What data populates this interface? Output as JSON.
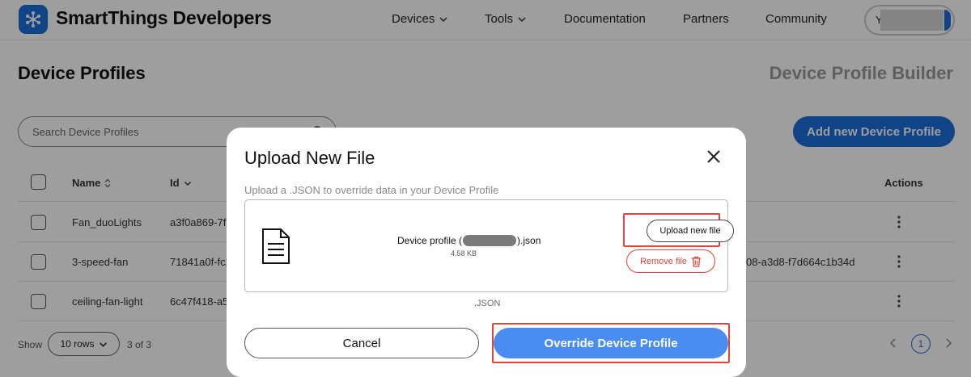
{
  "header": {
    "brand": "SmartThings Developers",
    "nav": {
      "devices": "Devices",
      "tools": "Tools",
      "documentation": "Documentation",
      "partners": "Partners",
      "community": "Community"
    },
    "user_initial": "Y"
  },
  "page": {
    "title": "Device Profiles",
    "builder_link": "Device Profile Builder",
    "search_placeholder": "Search Device Profiles",
    "add_button": "Add new Device Profile"
  },
  "table": {
    "columns": {
      "name": "Name",
      "id": "Id",
      "actions": "Actions"
    },
    "rows": [
      {
        "name": "Fan_duoLights",
        "id_visible": "a3f0a869-7f",
        "id_tail": ""
      },
      {
        "name": "3-speed-fan",
        "id_visible": "71841a0f-fc2",
        "id_tail": "08-a3d8-f7d664c1b34d"
      },
      {
        "name": "ceiling-fan-light",
        "id_visible": "6c47f418-a5",
        "id_tail": ""
      }
    ]
  },
  "footer": {
    "show_label": "Show",
    "rows_value": "10 rows",
    "count": "3 of 3",
    "current_page": "1"
  },
  "modal": {
    "title": "Upload New File",
    "subtitle": "Upload a .JSON to override data in your Device Profile",
    "file_name_prefix": "Device profile (",
    "file_name_suffix": ").json",
    "file_size": "4.58 KB",
    "upload_button": "Upload new file",
    "remove_button": "Remove file",
    "hint": ".JSON",
    "cancel_button": "Cancel",
    "override_button": "Override Device Profile"
  },
  "colors": {
    "accent": "#1a6fd8",
    "primary_button": "#4a8cef",
    "danger": "#e0453a",
    "overlay": "rgba(0,0,0,0.38)"
  }
}
